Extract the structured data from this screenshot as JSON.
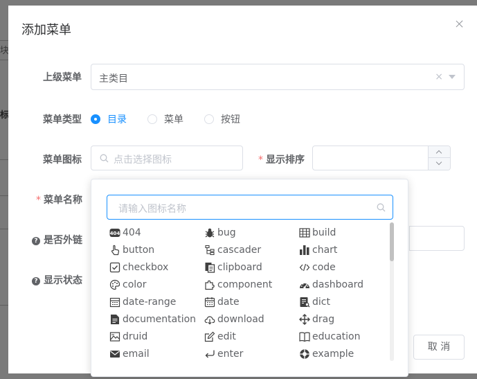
{
  "dialog": {
    "title": "添加菜单"
  },
  "form": {
    "parent_label": "上级菜单",
    "parent_value": "主类目",
    "clear_glyph": "×",
    "type_label": "菜单类型",
    "type_options": [
      {
        "label": "目录",
        "checked": true
      },
      {
        "label": "菜单",
        "checked": false
      },
      {
        "label": "按钮",
        "checked": false
      }
    ],
    "icon_label": "菜单图标",
    "icon_placeholder": "点击选择图标",
    "order_required": "*",
    "order_label": "显示排序",
    "name_required": "*",
    "name_label": "菜单名称",
    "external_label": "是否外链",
    "visible_label": "显示状态",
    "help_glyph": "?"
  },
  "popover": {
    "search_placeholder": "请输入图标名称",
    "icons": [
      {
        "name": "404",
        "icon": "404-icon"
      },
      {
        "name": "bug",
        "icon": "bug-icon"
      },
      {
        "name": "build",
        "icon": "build-icon"
      },
      {
        "name": "button",
        "icon": "button-icon"
      },
      {
        "name": "cascader",
        "icon": "cascader-icon"
      },
      {
        "name": "chart",
        "icon": "chart-icon"
      },
      {
        "name": "checkbox",
        "icon": "checkbox-icon"
      },
      {
        "name": "clipboard",
        "icon": "clipboard-icon"
      },
      {
        "name": "code",
        "icon": "code-icon"
      },
      {
        "name": "color",
        "icon": "color-icon"
      },
      {
        "name": "component",
        "icon": "component-icon"
      },
      {
        "name": "dashboard",
        "icon": "dashboard-icon"
      },
      {
        "name": "date-range",
        "icon": "date-range-icon"
      },
      {
        "name": "date",
        "icon": "date-icon"
      },
      {
        "name": "dict",
        "icon": "dict-icon"
      },
      {
        "name": "documentation",
        "icon": "documentation-icon"
      },
      {
        "name": "download",
        "icon": "download-icon"
      },
      {
        "name": "drag",
        "icon": "drag-icon"
      },
      {
        "name": "druid",
        "icon": "druid-icon"
      },
      {
        "name": "edit",
        "icon": "edit-icon"
      },
      {
        "name": "education",
        "icon": "education-icon"
      },
      {
        "name": "email",
        "icon": "email-icon"
      },
      {
        "name": "enter",
        "icon": "enter-icon"
      },
      {
        "name": "example",
        "icon": "example-icon"
      }
    ]
  },
  "footer": {
    "cancel_label": "取 消"
  },
  "backdrop": {
    "fragment_1": "块",
    "fragment_2": "标"
  },
  "colors": {
    "primary": "#1890ff",
    "required": "#f56c6c",
    "text": "#606266",
    "border": "#dcdfe6"
  }
}
